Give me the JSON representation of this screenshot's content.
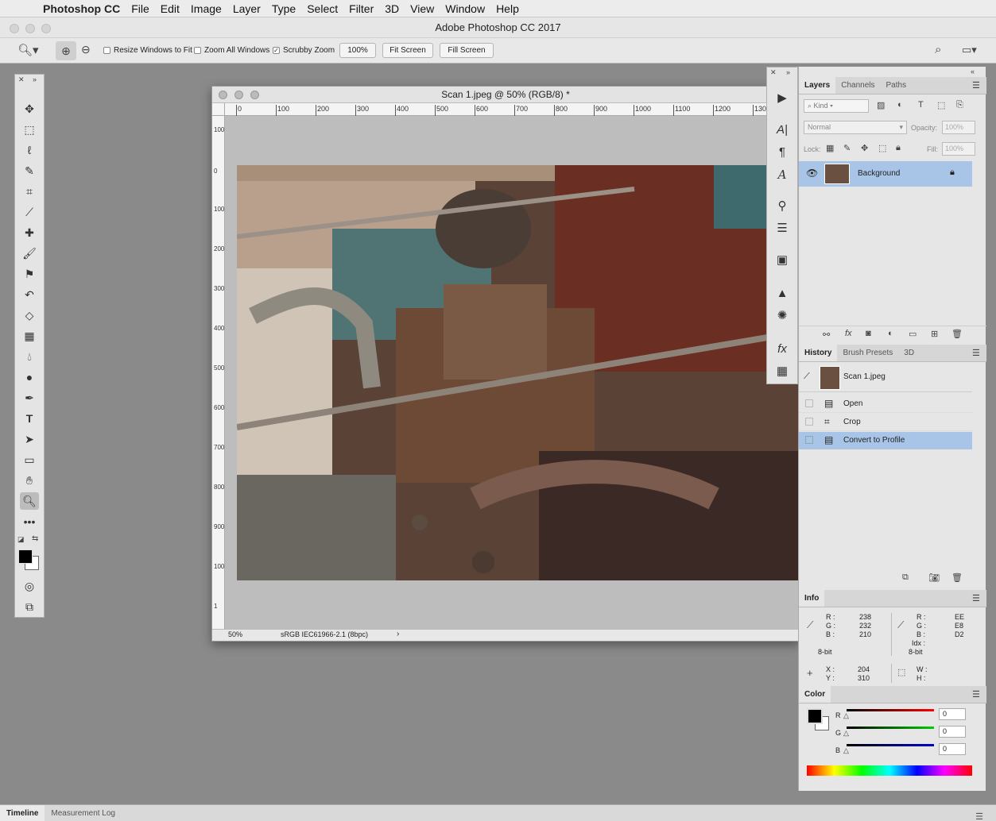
{
  "menubar": {
    "app_name": "Photoshop CC",
    "items": [
      "File",
      "Edit",
      "Image",
      "Layer",
      "Type",
      "Select",
      "Filter",
      "3D",
      "View",
      "Window",
      "Help"
    ]
  },
  "window_title": "Adobe Photoshop CC 2017",
  "options_bar": {
    "resize_windows_label": "Resize Windows to Fit",
    "zoom_all_label": "Zoom All Windows",
    "scrubby_zoom_label": "Scrubby Zoom",
    "zoom_percent": "100%",
    "fit_screen_label": "Fit Screen",
    "fill_screen_label": "Fill Screen"
  },
  "document": {
    "title": "Scan 1.jpeg @ 50% (RGB/8) *",
    "zoom": "50%",
    "profile": "sRGB IEC61966-2.1 (8bpc)",
    "ruler_h": [
      "0",
      "100",
      "200",
      "300",
      "400",
      "500",
      "600",
      "700",
      "800",
      "900",
      "1000",
      "1100",
      "1200",
      "130"
    ],
    "ruler_v": [
      "100",
      "0",
      "100",
      "200",
      "300",
      "400",
      "500",
      "600",
      "700",
      "800",
      "900",
      "100",
      "1"
    ]
  },
  "layers_panel": {
    "tabs": [
      "Layers",
      "Channels",
      "Paths"
    ],
    "kind_label": "Kind",
    "blend_mode": "Normal",
    "opacity_label": "Opacity:",
    "opacity_value": "100%",
    "lock_label": "Lock:",
    "fill_label": "Fill:",
    "fill_value": "100%",
    "layer_name": "Background"
  },
  "history_panel": {
    "tabs": [
      "History",
      "Brush Presets",
      "3D"
    ],
    "snapshot": "Scan 1.jpeg",
    "items": [
      "Open",
      "Crop",
      "Convert to Profile"
    ]
  },
  "info_panel": {
    "tab": "Info",
    "r_label": "R :",
    "g_label": "G :",
    "b_label": "B :",
    "r_value": "238",
    "g_value": "232",
    "b_value": "210",
    "r_hex": "EE",
    "g_hex": "E8",
    "b_hex": "D2",
    "idx_label": "Idx :",
    "bit_left": "8-bit",
    "bit_right": "8-bit",
    "x_label": "X :",
    "y_label": "Y :",
    "x_value": "204",
    "y_value": "310",
    "w_label": "W :",
    "h_label": "H :"
  },
  "color_panel": {
    "tab": "Color",
    "r_label": "R",
    "g_label": "G",
    "b_label": "B",
    "r_value": "0",
    "g_value": "0",
    "b_value": "0",
    "foreground": "#000000",
    "background": "#ffffff"
  },
  "bottom_tabs": [
    "Timeline",
    "Measurement Log"
  ]
}
